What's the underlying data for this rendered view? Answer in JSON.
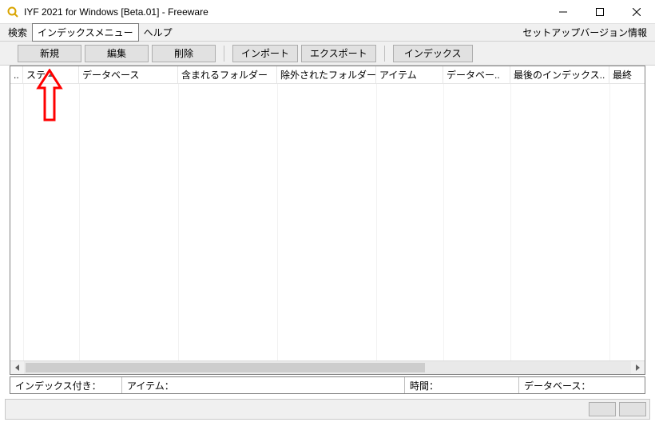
{
  "window": {
    "title": "IYF 2021 for Windows [Beta.01] - Freeware"
  },
  "menubar": {
    "search": "検索",
    "index_menu": "インデックスメニュー",
    "help": "ヘルプ",
    "setup_version_info": "セットアップバージョン情報"
  },
  "toolbar": {
    "new": "新規",
    "edit": "編集",
    "delete": "削除",
    "import": "インポート",
    "export": "エクスポート",
    "index": "インデックス"
  },
  "columns": {
    "blank": "..",
    "status": "ステ",
    "database": "データベース",
    "included_folders": "含まれるフォルダー",
    "excluded_folders": "除外されたフォルダー",
    "items": "アイテム",
    "database2": "データベー..",
    "last_index": "最後のインデックス..",
    "last": "最終"
  },
  "status": {
    "indexed": "インデックス付き：",
    "items": "アイテム：",
    "time": "時間：",
    "database": "データベース："
  }
}
